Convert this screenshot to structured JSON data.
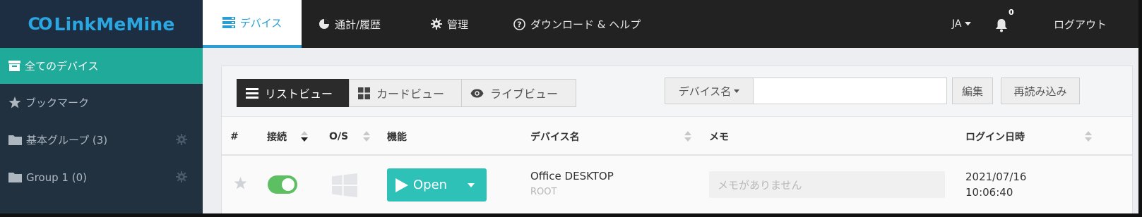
{
  "brand": {
    "logo_glyph": "CO",
    "logo_text": "LinkMeMine",
    "color": "#2aa6e0"
  },
  "nav": {
    "tabs": [
      {
        "label": "デバイス",
        "icon": "server-icon"
      },
      {
        "label": "通計/履歴",
        "icon": "pie-chart-icon"
      },
      {
        "label": "管理",
        "icon": "gear-icon"
      },
      {
        "label": "ダウンロード & ヘルプ",
        "icon": "question-circle-icon"
      }
    ],
    "language": "JA",
    "notification_count": "0",
    "logout_label": "ログアウト"
  },
  "sidebar": {
    "items": [
      {
        "label": "全てのデバイス",
        "icon": "archive-icon"
      },
      {
        "label": "ブックマーク",
        "icon": "star-icon"
      },
      {
        "label": "基本グループ (3)",
        "icon": "folder-icon"
      },
      {
        "label": "Group 1 (0)",
        "icon": "folder-icon"
      }
    ],
    "active_color": "#1faa99"
  },
  "toolbar": {
    "views": [
      {
        "label": "リストビュー",
        "icon": "list-icon"
      },
      {
        "label": "カードビュー",
        "icon": "grid-icon"
      },
      {
        "label": "ライブビュー",
        "icon": "eye-icon"
      }
    ],
    "search_field_label": "デバイス名",
    "search_value": "",
    "edit_label": "編集",
    "reload_label": "再読み込み"
  },
  "table": {
    "headers": {
      "num": "#",
      "connection": "接続",
      "os": "O/S",
      "function": "機能",
      "device_name": "デバイス名",
      "memo": "メモ",
      "login": "ログイン日時"
    },
    "rows": [
      {
        "bookmarked": false,
        "connected": true,
        "os": "windows-icon",
        "action_label": "Open",
        "device_name": "Office DESKTOP",
        "device_user": "ROOT",
        "memo_placeholder": "メモがありません",
        "login_date": "2021/07/16",
        "login_time": "10:06:40"
      }
    ]
  },
  "colors": {
    "topbar": "#222222",
    "sidebar": "#223140",
    "accent": "#2a9fd6",
    "toggle_on": "#5cbf62",
    "open_button": "#2ec1b8"
  }
}
